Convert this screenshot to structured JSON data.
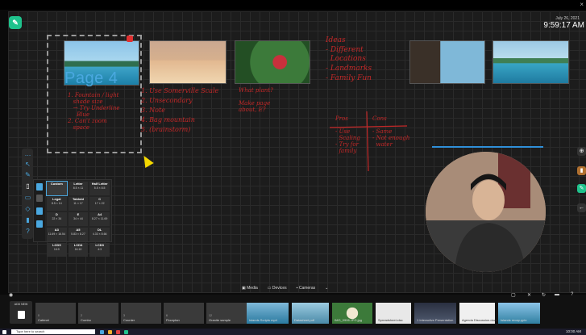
{
  "window": {
    "close_glyph": "×"
  },
  "clock": {
    "date": "July 26, 2021",
    "time": "9:59:17 AM"
  },
  "page": {
    "label": "Page 4"
  },
  "notes": {
    "slide1": "1. Fountain / light\n   shade size\n   → Try Underline\n     Blue\n2. Can't zoom\n   space",
    "slide2": "1. Use Somerville Scale\n2. Unsecondary\n3. Note\n4. Bag mountain\n5. (brainstorm)",
    "slide3": "What plant?\n\nMake page\nabout, E?",
    "ideas": "Ideas\n- Different\n  Locations\n- Landmarks\n- Family Fun",
    "pros": "Pros\n\n- Use\n  Scaling\n- Try for\n  family",
    "cons": "Cons\n\n- Same\n- Not enough\n  water"
  },
  "page_sizes": [
    {
      "name": "Custom",
      "size": ""
    },
    {
      "name": "Letter",
      "size": "8.5 × 11"
    },
    {
      "name": "Half Letter",
      "size": "5.5 × 8.5"
    },
    {
      "name": "Legal",
      "size": "8.5 × 14"
    },
    {
      "name": "Tabloid",
      "size": "11 × 17"
    },
    {
      "name": "C",
      "size": "17 × 22"
    },
    {
      "name": "D",
      "size": "22 × 34"
    },
    {
      "name": "E",
      "size": "34 × 44"
    },
    {
      "name": "A4",
      "size": "8.27 × 11.69"
    },
    {
      "name": "A3",
      "size": "11.69 × 16.54"
    },
    {
      "name": "A5",
      "size": "5.83 × 8.27"
    },
    {
      "name": "DL",
      "size": "4.33 × 8.66"
    },
    {
      "name": "LCD9",
      "size": "16:9"
    },
    {
      "name": "LCD4",
      "size": "16:10"
    },
    {
      "name": "LCD3",
      "size": "4:3"
    }
  ],
  "tabs": {
    "media": "Media",
    "devices": "Devices",
    "cameras": "Cameras"
  },
  "tray": {
    "add_new": "ADD NEW",
    "items": [
      {
        "tag": "0",
        "caption": "Cabinet"
      },
      {
        "tag": "2",
        "caption": "Combo"
      },
      {
        "tag": "3",
        "caption": "Counter"
      },
      {
        "tag": "6",
        "caption": "Floorplan"
      },
      {
        "tag": "12",
        "caption": "Granite sample"
      }
    ],
    "files": [
      {
        "caption": "Islands Scripts mp4"
      },
      {
        "caption": "Datasheet.pdf"
      },
      {
        "caption": "IMG_0906.JPG.jpg"
      },
      {
        "caption": "Spreadsheet.xlsx"
      },
      {
        "caption": "1 Interactive Presentation"
      },
      {
        "caption": "Agenda Discussion.docx"
      },
      {
        "caption": "Islands recap.pptx"
      }
    ]
  },
  "taskbar": {
    "search_placeholder": "Type here to search",
    "time": "10:00 AM"
  },
  "colors": {
    "accent": "#4aa8e0",
    "ink": "#c42828",
    "logo": "#1fc28c"
  }
}
